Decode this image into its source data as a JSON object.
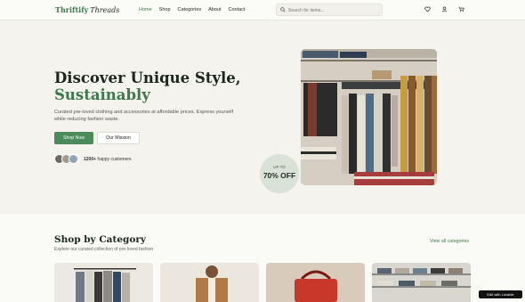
{
  "header": {
    "brand": "Thriftify",
    "brand_sub": "Threads",
    "nav": [
      "Home",
      "Shop",
      "Categories",
      "About",
      "Contact"
    ],
    "active_nav": "Home",
    "search_placeholder": "Search for items...",
    "icons": [
      "heart-icon",
      "user-icon",
      "cart-icon"
    ]
  },
  "hero": {
    "title_line1": "Discover Unique Style,",
    "title_line2": "Sustainably",
    "description": "Curated pre-loved clothing and accessories at affordable prices. Express yourself while reducing fashion waste.",
    "primary_button": "Shop Now",
    "secondary_button": "Our Mission",
    "customers_count": "1200+",
    "customers_label": "happy customers",
    "badge_top": "UP TO",
    "badge_main": "70% OFF"
  },
  "categories": {
    "title": "Shop by Category",
    "subtitle": "Explore our curated collection of pre-loved fashion",
    "view_all": "View all categories"
  },
  "lovable_badge": "Edit with Lovable",
  "colors": {
    "accent": "#3c7a4b",
    "button": "#4b8a5a",
    "background": "#f4f3ee"
  }
}
